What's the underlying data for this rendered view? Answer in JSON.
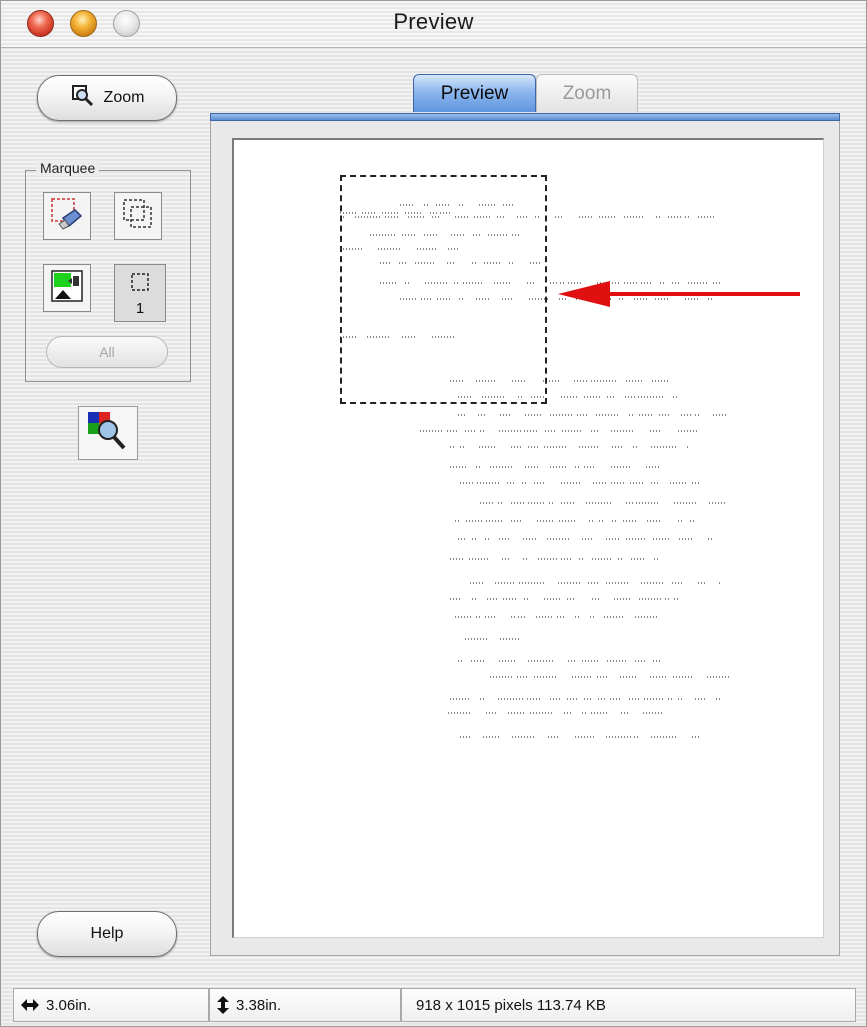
{
  "window": {
    "title": "Preview"
  },
  "sidebar": {
    "zoom_button": "Zoom",
    "marquee_label": "Marquee",
    "marquee_count": "1",
    "all_button": "All",
    "help_button": "Help"
  },
  "tabs": [
    {
      "label": "Preview",
      "active": true
    },
    {
      "label": "Zoom",
      "active": false
    }
  ],
  "status": {
    "width": "3.06in.",
    "height": "3.38in.",
    "info": "918 x 1015 pixels 113.74 KB"
  },
  "colors": {
    "tab_active": "#5f95de",
    "arrow": "#e01010",
    "close_light": "#e0462e",
    "minimize_light": "#f0a52a"
  },
  "icons": [
    "zoom-magnifier-icon",
    "marquee-select-icon",
    "marquee-overlap-icon",
    "auto-select-icon",
    "marquee-counter-icon",
    "scan-magnifier-icon",
    "horizontal-size-icon",
    "vertical-size-icon"
  ]
}
